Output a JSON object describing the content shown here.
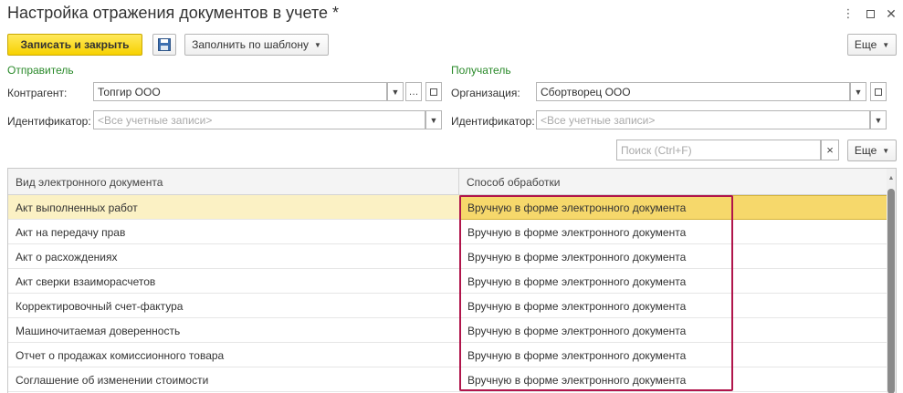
{
  "window": {
    "title": "Настройка отражения документов в учете *"
  },
  "toolbar": {
    "save_close_label": "Записать и закрыть",
    "fill_template_label": "Заполнить по шаблону",
    "more_label": "Еще"
  },
  "sender": {
    "section_label": "Отправитель",
    "counterparty_label": "Контрагент:",
    "counterparty_value": "Топгир ООО",
    "identifier_label": "Идентификатор:",
    "identifier_placeholder": "<Все учетные записи>"
  },
  "recipient": {
    "section_label": "Получатель",
    "organization_label": "Организация:",
    "organization_value": "Сбортворец ООО",
    "identifier_label": "Идентификатор:",
    "identifier_placeholder": "<Все учетные записи>"
  },
  "search": {
    "placeholder": "Поиск (Ctrl+F)",
    "clear_glyph": "×",
    "more_label": "Еще"
  },
  "table": {
    "columns": [
      "Вид электронного документа",
      "Способ обработки"
    ],
    "rows": [
      {
        "doc_type": "Акт выполненных работ",
        "method": "Вручную в форме электронного документа",
        "selected": true
      },
      {
        "doc_type": "Акт на передачу прав",
        "method": "Вручную в форме электронного документа"
      },
      {
        "doc_type": "Акт о расхождениях",
        "method": "Вручную в форме электронного документа"
      },
      {
        "doc_type": "Акт сверки взаиморасчетов",
        "method": "Вручную в форме электронного документа"
      },
      {
        "doc_type": "Корректировочный счет-фактура",
        "method": "Вручную в форме электронного документа"
      },
      {
        "doc_type": "Машиночитаемая доверенность",
        "method": "Вручную в форме электронного документа"
      },
      {
        "doc_type": "Отчет о продажах комиссионного товара",
        "method": "Вручную в форме электронного документа"
      },
      {
        "doc_type": "Соглашение об изменении стоимости",
        "method": "Вручную в форме электронного документа"
      }
    ]
  },
  "colors": {
    "primary_button": "#f7d100",
    "section_label": "#2a8a2a",
    "selected_row": "#fbf1c4",
    "selected_cell": "#f6d86b",
    "highlight_frame": "#b0154b"
  },
  "icons": {
    "kebab": "kebab-menu-icon",
    "maximize": "maximize-icon",
    "close": "close-icon",
    "save": "floppy-disk-icon",
    "dropdown": "chevron-down-icon",
    "open": "open-link-icon",
    "select": "ellipsis-icon"
  }
}
